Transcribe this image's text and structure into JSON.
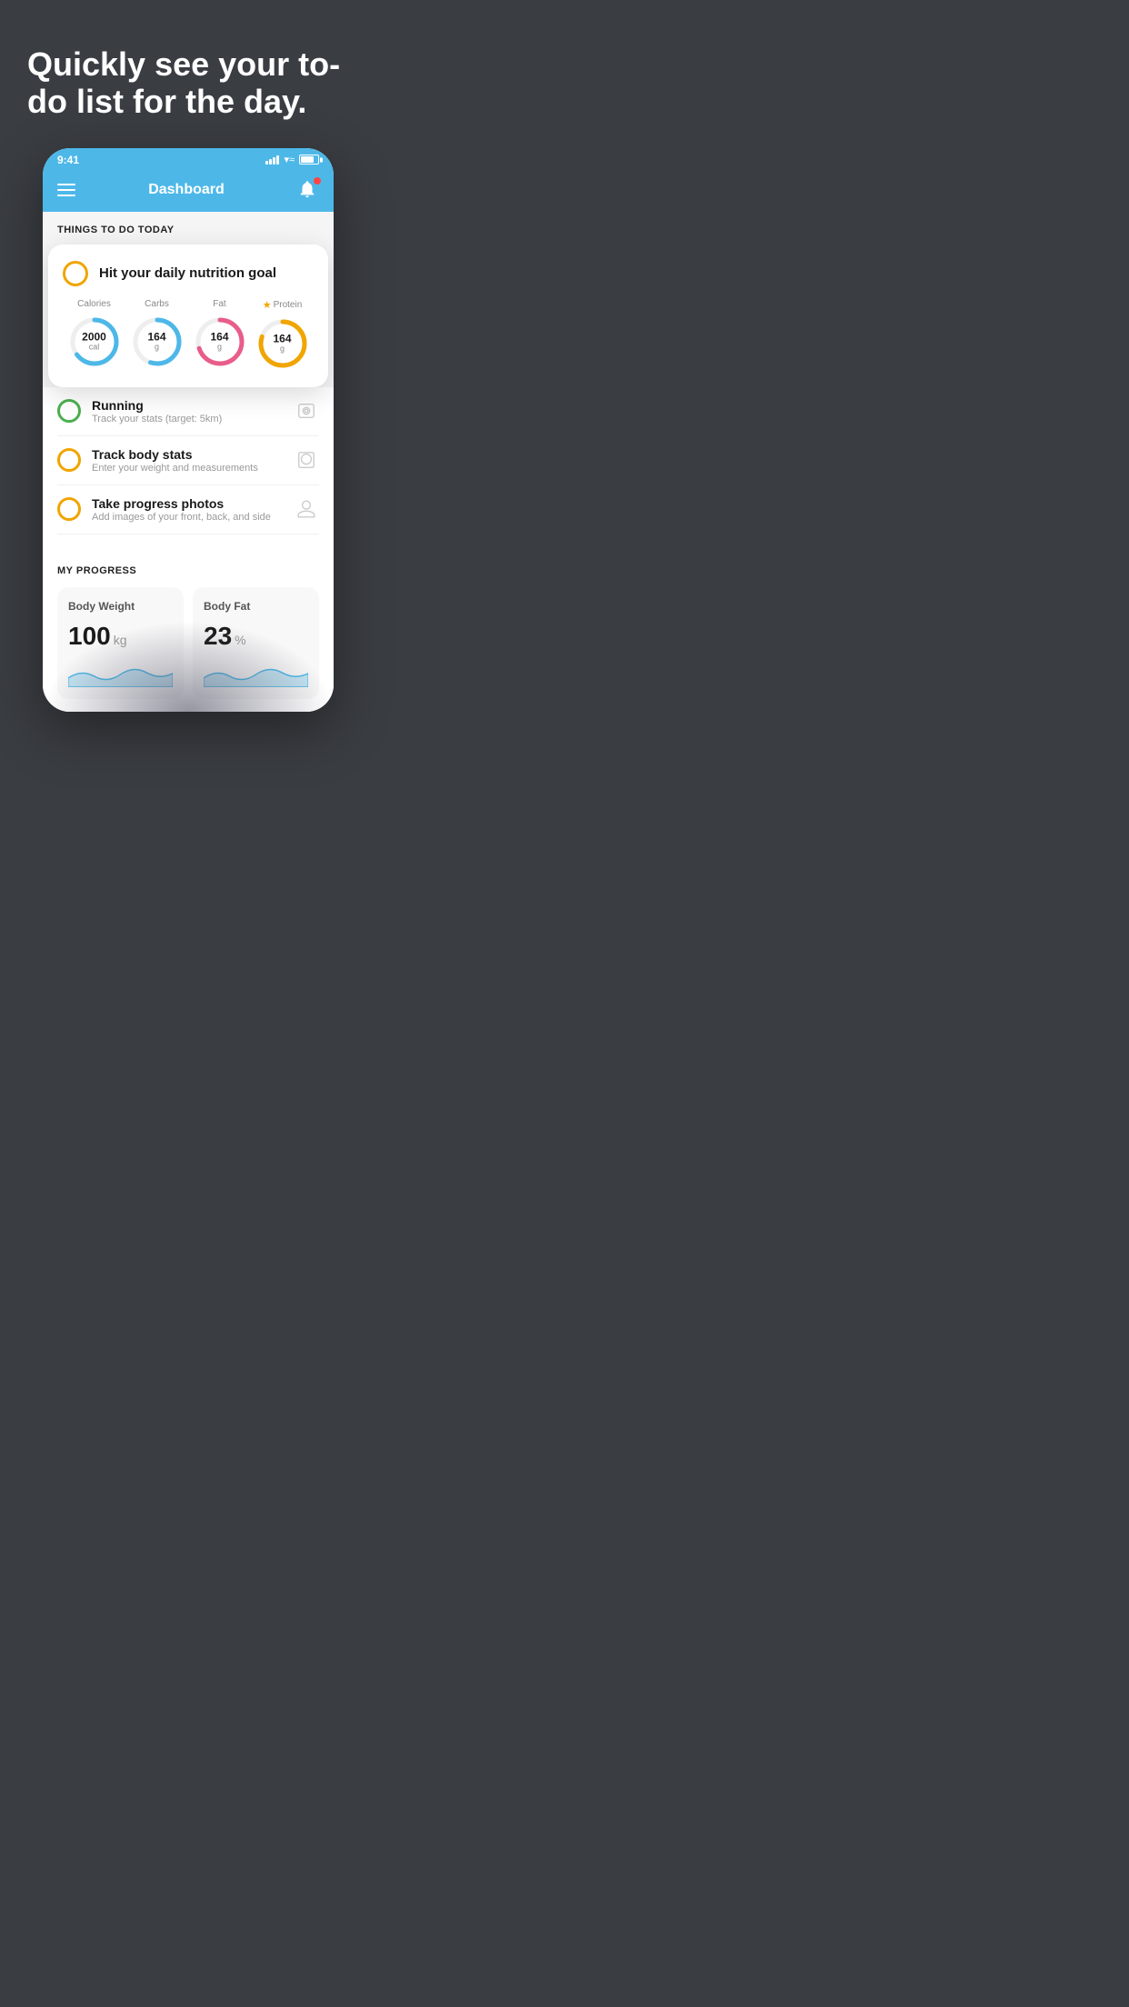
{
  "hero": {
    "title": "Quickly see your to-do list for the day."
  },
  "phone": {
    "statusBar": {
      "time": "9:41"
    },
    "navBar": {
      "title": "Dashboard"
    },
    "content": {
      "thingsToDoTitle": "THINGS TO DO TODAY",
      "floatingCard": {
        "checkColor": "yellow",
        "title": "Hit your daily nutrition goal",
        "nutrition": [
          {
            "label": "Calories",
            "value": "2000",
            "unit": "cal",
            "color": "#4db8e8",
            "pct": 65,
            "starred": false
          },
          {
            "label": "Carbs",
            "value": "164",
            "unit": "g",
            "color": "#4db8e8",
            "pct": 55,
            "starred": false
          },
          {
            "label": "Fat",
            "value": "164",
            "unit": "g",
            "color": "#e85d8a",
            "pct": 70,
            "starred": false
          },
          {
            "label": "Protein",
            "value": "164",
            "unit": "g",
            "color": "#f0a500",
            "pct": 80,
            "starred": true
          }
        ]
      },
      "todoItems": [
        {
          "id": "running",
          "circleColor": "green",
          "title": "Running",
          "subtitle": "Track your stats (target: 5km)",
          "icon": "shoe"
        },
        {
          "id": "body-stats",
          "circleColor": "yellow",
          "title": "Track body stats",
          "subtitle": "Enter your weight and measurements",
          "icon": "scale"
        },
        {
          "id": "progress-photos",
          "circleColor": "yellow",
          "title": "Take progress photos",
          "subtitle": "Add images of your front, back, and side",
          "icon": "person"
        }
      ],
      "progressSection": {
        "title": "MY PROGRESS",
        "cards": [
          {
            "id": "body-weight",
            "title": "Body Weight",
            "value": "100",
            "unit": "kg"
          },
          {
            "id": "body-fat",
            "title": "Body Fat",
            "value": "23",
            "unit": "%"
          }
        ]
      }
    }
  }
}
